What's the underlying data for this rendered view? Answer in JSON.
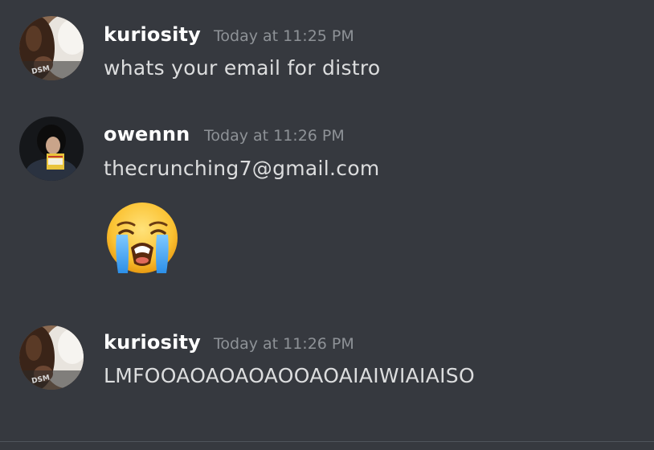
{
  "messages": [
    {
      "username": "kuriosity",
      "timestamp": "Today at 11:25 PM",
      "text": "whats your email for distro",
      "avatar_icon": "kuriosity-avatar"
    },
    {
      "username": "owennn",
      "timestamp": "Today at 11:26 PM",
      "text": "thecrunching7@gmail.com",
      "emoji": "loudly-crying-face",
      "avatar_icon": "owennn-avatar"
    },
    {
      "username": "kuriosity",
      "timestamp": "Today at 11:26 PM",
      "text": "LMFOOAOAOAOAOOAOAIAIWIAIAISO",
      "avatar_icon": "kuriosity-avatar"
    }
  ],
  "colors": {
    "background": "#36393f",
    "username": "#ffffff",
    "timestamp": "#8e9297",
    "message_text": "#dcddde"
  }
}
